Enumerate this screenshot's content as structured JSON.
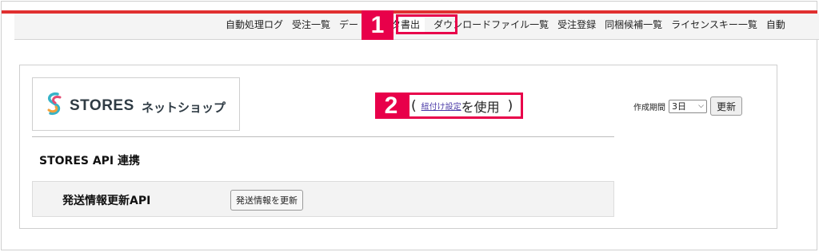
{
  "nav": {
    "items": [
      {
        "label": "自動処理ログ"
      },
      {
        "label": "受注一覧"
      },
      {
        "label": "デー"
      },
      {
        "label": "データ書出"
      },
      {
        "label": "ダウンロードファイル一覧"
      },
      {
        "label": "受注登録"
      },
      {
        "label": "同梱候補一覧"
      },
      {
        "label": "ライセンスキー一覧"
      },
      {
        "label": "自動"
      }
    ]
  },
  "annotations": {
    "step1": "1",
    "step2": "2"
  },
  "logo": {
    "name": "STORES",
    "sub": "ネットショップ",
    "icon": "stores-logo-icon"
  },
  "usage": {
    "open_paren": "(",
    "link": "紐付け設定",
    "text": "を使用",
    "close_paren": ")"
  },
  "period": {
    "label": "作成期間",
    "selected": "3日",
    "button": "更新"
  },
  "section": {
    "title": "STORES API 連携"
  },
  "api": {
    "label": "発送情報更新API",
    "button": "発送情報を更新"
  },
  "colors": {
    "accent_red": "#e8004a",
    "top_bar": "#e03030"
  }
}
